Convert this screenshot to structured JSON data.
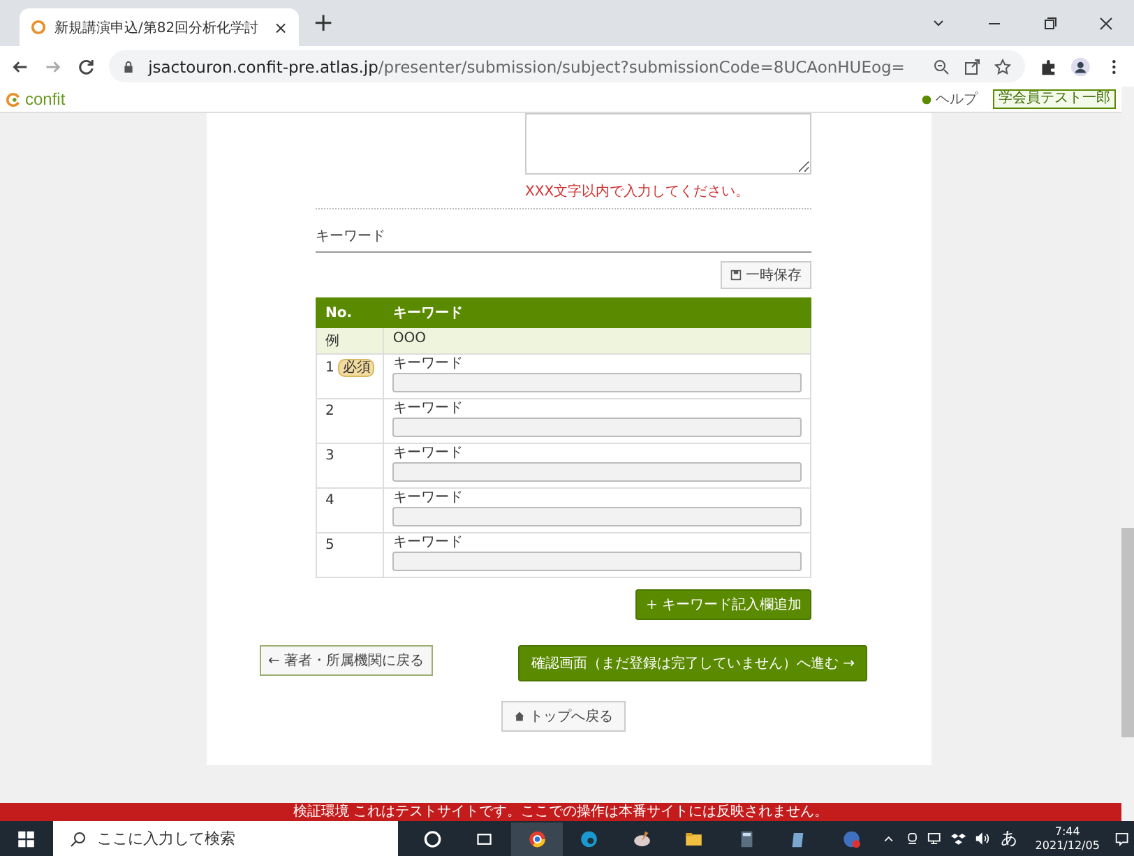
{
  "browser": {
    "tab_title": "新規講演申込/第82回分析化学討",
    "tab_close": "×",
    "new_tab": "+",
    "url_host": "jsactouron.confit-pre.atlas.jp",
    "url_path": "/presenter/submission/subject?submissionCode=8UCAonHUEog="
  },
  "site_header": {
    "logo": "confit",
    "help": "ヘルプ",
    "user": "学会員テスト一郎"
  },
  "form": {
    "error": "XXX文字以内で入力してください。",
    "section_title": "キーワード",
    "save_button": "一時保存",
    "columns": [
      "No.",
      "キーワード"
    ],
    "example": {
      "no": "例",
      "text": "OOO"
    },
    "required_badge": "必須",
    "rows": [
      {
        "no": "1",
        "label": "キーワード",
        "required": true
      },
      {
        "no": "2",
        "label": "キーワード",
        "required": false
      },
      {
        "no": "3",
        "label": "キーワード",
        "required": false
      },
      {
        "no": "4",
        "label": "キーワード",
        "required": false
      },
      {
        "no": "5",
        "label": "キーワード",
        "required": false
      }
    ],
    "add_button": "+ キーワード記入欄追加",
    "back_button": "← 著者・所属機関に戻る",
    "next_button": "確認画面（まだ登録は完了していません）へ進む →",
    "top_button": "トップへ戻る"
  },
  "footer_notice": "検証環境 これはテストサイトです。ここでの操作は本番サイトには反映されません。",
  "taskbar": {
    "search_placeholder": "ここに入力して検索",
    "ime": "あ",
    "time": "7:44",
    "date": "2021/12/05"
  }
}
